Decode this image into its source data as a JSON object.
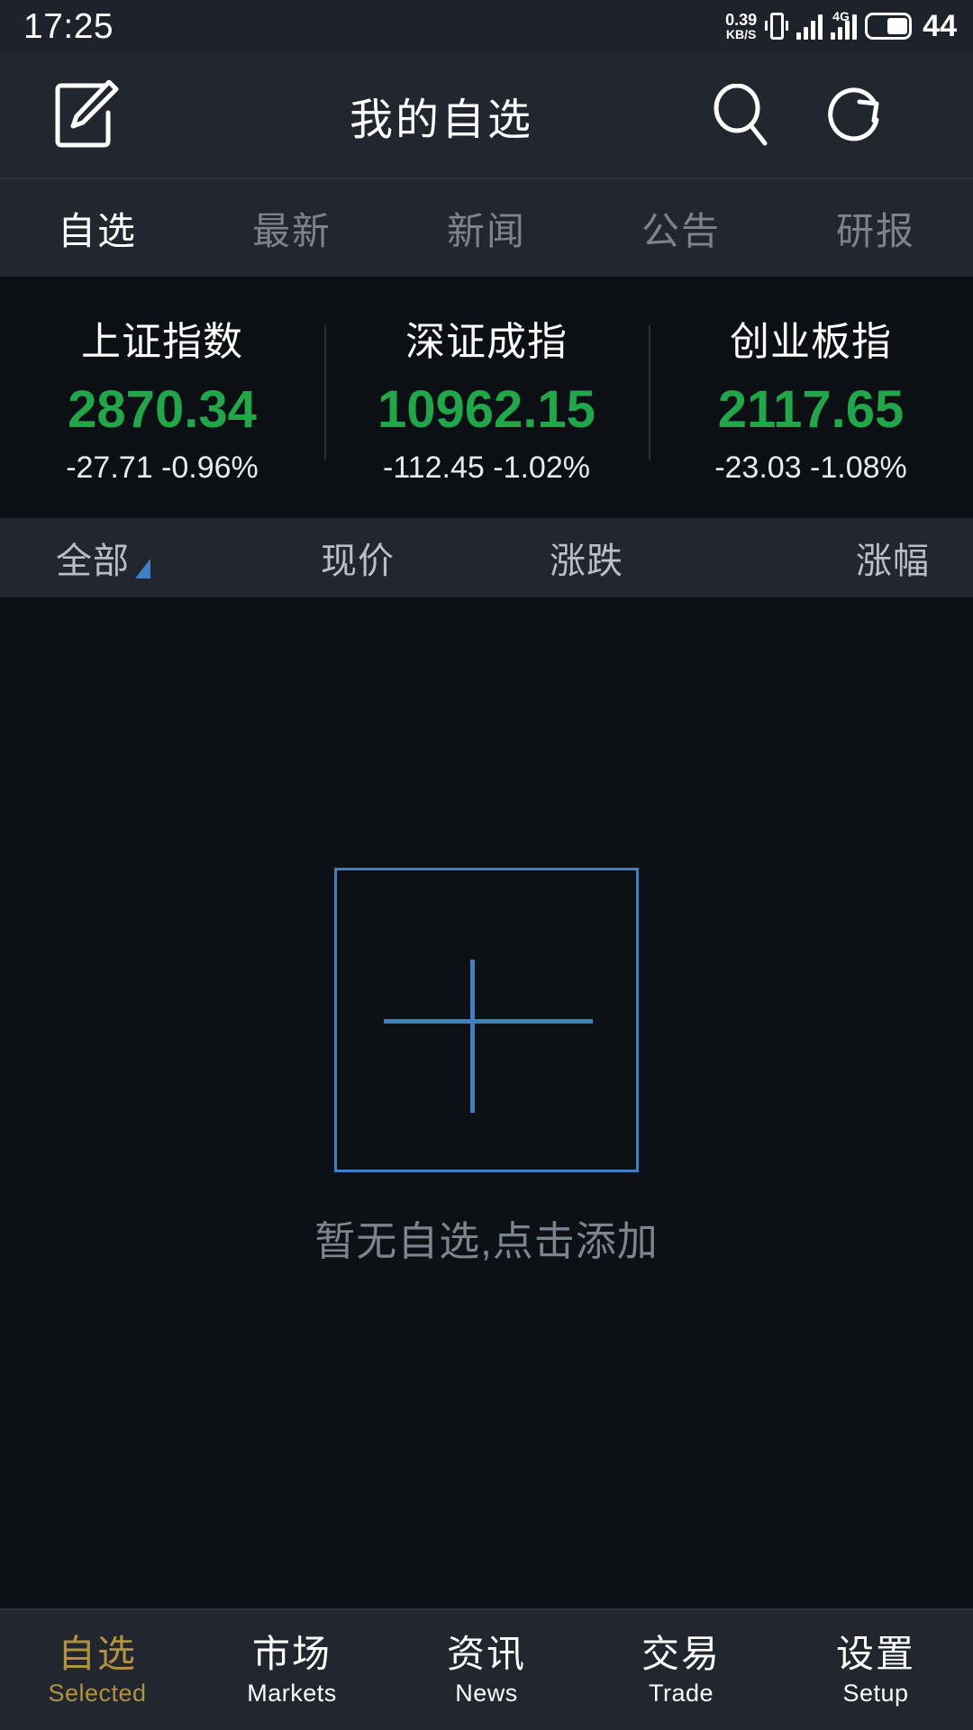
{
  "statusbar": {
    "time": "17:25",
    "netspeed_value": "0.39",
    "netspeed_unit": "KB/S",
    "battery_level": "44",
    "icons": [
      "vibrate-icon",
      "signal-bars-icon",
      "signal-4g-icon",
      "battery-icon"
    ]
  },
  "header": {
    "title": "我的自选",
    "edit_icon": "edit-pencil-icon",
    "search_icon": "search-icon",
    "refresh_icon": "refresh-icon"
  },
  "tabs": [
    {
      "label": "自选",
      "active": true
    },
    {
      "label": "最新",
      "active": false
    },
    {
      "label": "新闻",
      "active": false
    },
    {
      "label": "公告",
      "active": false
    },
    {
      "label": "研报",
      "active": false
    }
  ],
  "indices": [
    {
      "name": "上证指数",
      "value": "2870.34",
      "change": "-27.71 -0.96%"
    },
    {
      "name": "深证成指",
      "value": "10962.15",
      "change": "-112.45 -1.02%"
    },
    {
      "name": "创业板指",
      "value": "2117.65",
      "change": "-23.03 -1.08%"
    }
  ],
  "sort_row": {
    "filter_label": "全部",
    "filter_caret_icon": "sort-triangle-icon",
    "columns": [
      "现价",
      "涨跌",
      "涨幅"
    ]
  },
  "empty_state": {
    "add_icon": "add-plus-box-icon",
    "message": "暂无自选,点击添加"
  },
  "bottom_nav": [
    {
      "cn": "自选",
      "en": "Selected",
      "active": true
    },
    {
      "cn": "市场",
      "en": "Markets",
      "active": false
    },
    {
      "cn": "资讯",
      "en": "News",
      "active": false
    },
    {
      "cn": "交易",
      "en": "Trade",
      "active": false
    },
    {
      "cn": "设置",
      "en": "Setup",
      "active": false
    }
  ],
  "colors": {
    "down_green": "#1fa74a",
    "accent_blue": "#3f7fc4",
    "active_gold": "#b2913f",
    "header_bg": "#22262e",
    "panel_bg": "#0c0f14",
    "content_bg": "#0d1116"
  }
}
